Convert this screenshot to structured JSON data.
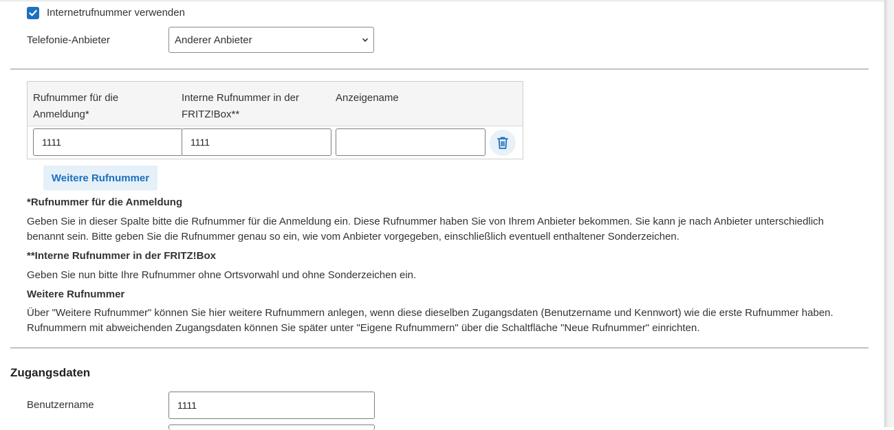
{
  "top": {
    "checkbox_label": "Internetrufnummer verwenden",
    "checkbox_checked": true,
    "provider_label": "Telefonie-Anbieter",
    "provider_value": "Anderer Anbieter"
  },
  "table": {
    "headers": [
      {
        "line1": "Rufnummer für die",
        "line2": "Anmeldung*"
      },
      {
        "line1": "Interne Rufnummer in der",
        "line2": "FRITZ!Box**"
      },
      {
        "line1": "Anzeigename",
        "line2": ""
      }
    ],
    "row": {
      "login_number": "1111",
      "internal_number": "1111",
      "display_name": ""
    },
    "delete_icon": "trash-icon"
  },
  "more_button": "Weitere Rufnummer",
  "help": {
    "h1": "*Rufnummer für die Anmeldung",
    "p1_line1": "Geben Sie in dieser Spalte bitte die Rufnummer für die Anmeldung ein. Diese Rufnummer haben Sie von Ihrem Anbieter bekommen. Sie kann je nach Anbieter unterschiedlich",
    "p1_line2": "benannt sein. Bitte geben Sie die Rufnummer genau so ein, wie vom Anbieter vorgegeben, einschließlich eventuell enthaltener Sonderzeichen.",
    "h2": "**Interne Rufnummer in der FRITZ!Box",
    "p2": "Geben Sie nun bitte Ihre Rufnummer ohne Ortsvorwahl und ohne Sonderzeichen ein.",
    "h3": "Weitere Rufnummer",
    "p3_line1": "Über \"Weitere Rufnummer\" können Sie hier weitere Rufnummern anlegen, wenn diese dieselben Zugangsdaten (Benutzername und Kennwort) wie die erste Rufnummer haben.",
    "p3_line2": "Rufnummern mit abweichenden Zugangsdaten können Sie später unter \"Eigene Rufnummern\" über die Schaltfläche \"Neue Rufnummer\" einrichten."
  },
  "access": {
    "title": "Zugangsdaten",
    "username_label": "Benutzername",
    "username_value": "1111"
  },
  "colors": {
    "accent": "#1d6fbf",
    "button_bg": "#e6f0f8",
    "table_header_bg": "#f5f5f5"
  }
}
